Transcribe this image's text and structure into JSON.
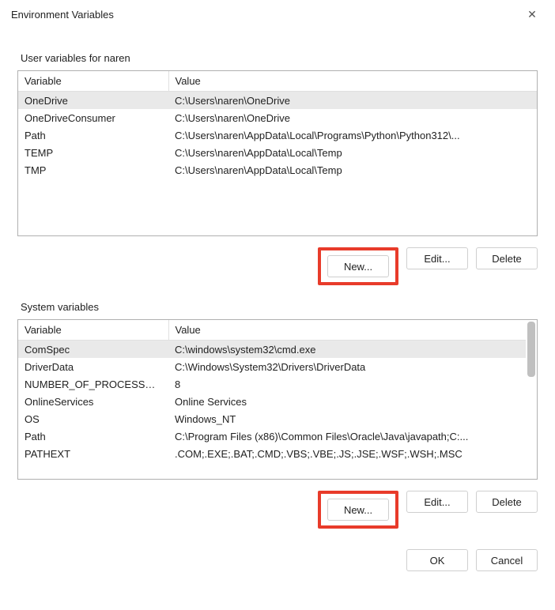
{
  "title": "Environment Variables",
  "user_section": {
    "label": "User variables for naren",
    "columns": {
      "var": "Variable",
      "val": "Value"
    },
    "rows": [
      {
        "var": "OneDrive",
        "val": "C:\\Users\\naren\\OneDrive",
        "selected": true
      },
      {
        "var": "OneDriveConsumer",
        "val": "C:\\Users\\naren\\OneDrive"
      },
      {
        "var": "Path",
        "val": "C:\\Users\\naren\\AppData\\Local\\Programs\\Python\\Python312\\..."
      },
      {
        "var": "TEMP",
        "val": "C:\\Users\\naren\\AppData\\Local\\Temp"
      },
      {
        "var": "TMP",
        "val": "C:\\Users\\naren\\AppData\\Local\\Temp"
      }
    ],
    "buttons": {
      "new": "New...",
      "edit": "Edit...",
      "delete": "Delete"
    }
  },
  "system_section": {
    "label": "System variables",
    "columns": {
      "var": "Variable",
      "val": "Value"
    },
    "rows": [
      {
        "var": "ComSpec",
        "val": "C:\\windows\\system32\\cmd.exe",
        "selected": true
      },
      {
        "var": "DriverData",
        "val": "C:\\Windows\\System32\\Drivers\\DriverData"
      },
      {
        "var": "NUMBER_OF_PROCESSORS",
        "val": "8"
      },
      {
        "var": "OnlineServices",
        "val": "Online Services"
      },
      {
        "var": "OS",
        "val": "Windows_NT"
      },
      {
        "var": "Path",
        "val": "C:\\Program Files (x86)\\Common Files\\Oracle\\Java\\javapath;C:..."
      },
      {
        "var": "PATHEXT",
        "val": ".COM;.EXE;.BAT;.CMD;.VBS;.VBE;.JS;.JSE;.WSF;.WSH;.MSC"
      }
    ],
    "buttons": {
      "new": "New...",
      "edit": "Edit...",
      "delete": "Delete"
    }
  },
  "footer": {
    "ok": "OK",
    "cancel": "Cancel"
  }
}
